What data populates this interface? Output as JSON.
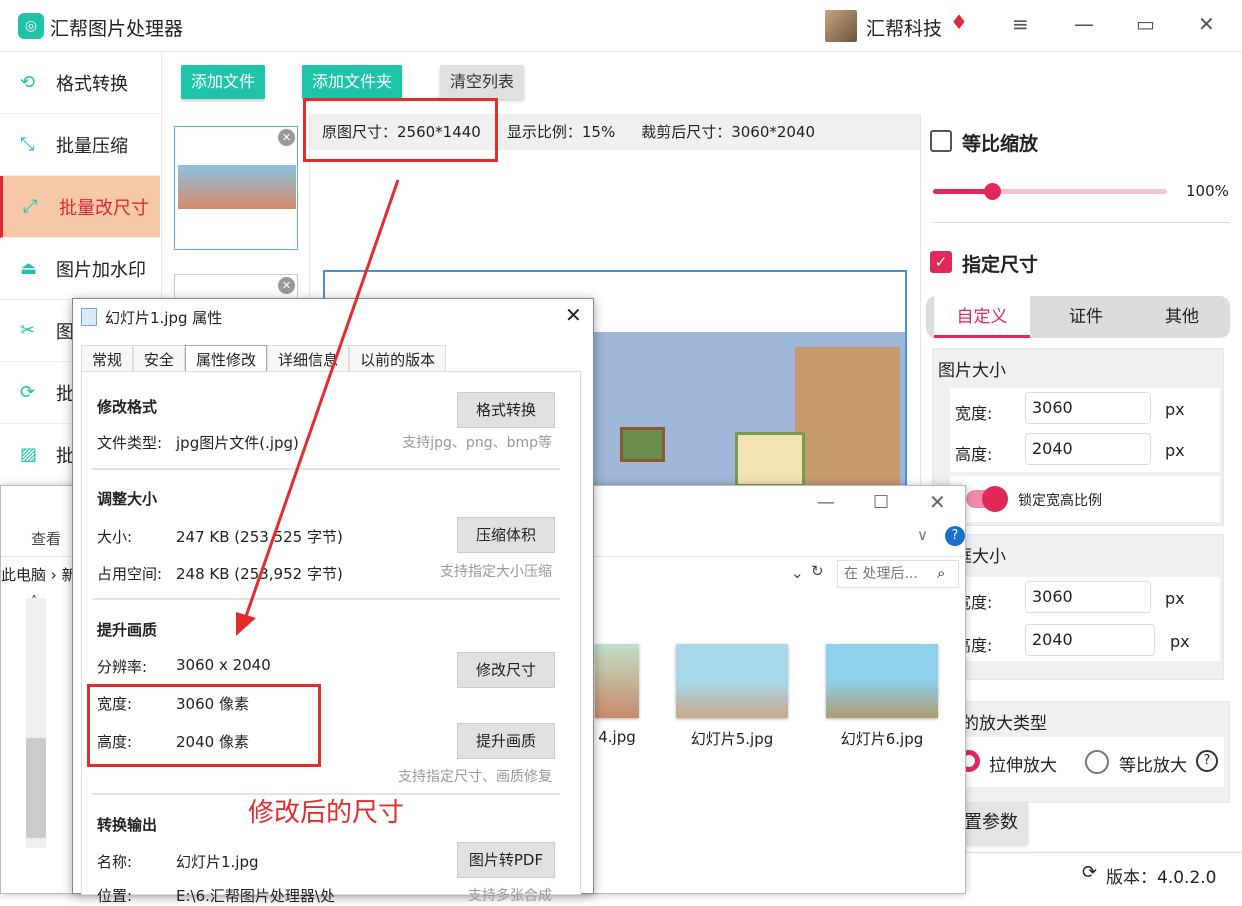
{
  "app": {
    "title": "汇帮图片处理器",
    "user": "汇帮科技",
    "version_label": "版本：4.0.2.0"
  },
  "sidebar": {
    "items": [
      {
        "label": "格式转换",
        "icon": "format-icon"
      },
      {
        "label": "批量压缩",
        "icon": "compress-icon"
      },
      {
        "label": "批量改尺寸",
        "icon": "resize-icon"
      },
      {
        "label": "图片加水印",
        "icon": "watermark-icon"
      },
      {
        "label": "图",
        "icon": "pdf-icon"
      },
      {
        "label": "批",
        "icon": "rotate-icon"
      },
      {
        "label": "批",
        "icon": "image-icon"
      }
    ]
  },
  "toolbar": {
    "add_file": "添加文件",
    "add_folder": "添加文件夹",
    "clear": "清空列表"
  },
  "infobar": {
    "original": "原图尺寸：2560*1440",
    "ratio": "显示比例：15%",
    "cropped": "裁剪后尺寸：3060*2040"
  },
  "right": {
    "proportional": "等比缩放",
    "zoom_value": "100%",
    "zoom_fraction": 0.25,
    "specify": "指定尺寸",
    "tabs": [
      "自定义",
      "证件",
      "其他"
    ],
    "image_size": {
      "title": "图片大小",
      "width_label": "宽度:",
      "width": "3060",
      "height_label": "高度:",
      "height": "2040",
      "unit": "px",
      "lock": "锁定宽高比例"
    },
    "crop_size": {
      "title": "切框大小",
      "width_label": "宽度:",
      "width": "3060",
      "height_label": "高度:",
      "height": "2040",
      "unit": "px"
    },
    "enlarge": {
      "title": "的放大类型",
      "opt1": "拉伸放大",
      "opt2": "等比放大",
      "help": "?"
    },
    "reset": "置参数"
  },
  "explorer": {
    "view": "查看",
    "crumb1": "此电脑",
    "crumb2": "新",
    "search_placeholder": "在 处理后...",
    "files": [
      "4.jpg",
      "幻灯片5.jpg",
      "幻灯片6.jpg"
    ]
  },
  "dialog": {
    "title": "幻灯片1.jpg 属性",
    "tabs": [
      "常规",
      "安全",
      "属性修改",
      "详细信息",
      "以前的版本"
    ],
    "s1": {
      "title": "修改格式",
      "type_label": "文件类型:",
      "type": "jpg图片文件(.jpg)",
      "btn": "格式转换",
      "hint": "支持jpg、png、bmp等"
    },
    "s2": {
      "title": "调整大小",
      "size_label": "大小:",
      "size": "247 KB (253,525 字节)",
      "disk_label": "占用空间:",
      "disk": "248 KB (253,952 字节)",
      "btn": "压缩体积",
      "hint": "支持指定大小压缩"
    },
    "s3": {
      "title": "提升画质",
      "res_label": "分辨率:",
      "res": "3060 x 2040",
      "btn1": "修改尺寸",
      "w_label": "宽度:",
      "w": "3060 像素",
      "h_label": "高度:",
      "h": "2040 像素",
      "btn2": "提升画质",
      "hint": "支持指定尺寸、画质修复"
    },
    "s4": {
      "title": "转换输出",
      "name_label": "名称:",
      "name": "幻灯片1.jpg",
      "loc_label": "位置:",
      "loc": "E:\\6.汇帮图片处理器\\处",
      "btn": "图片转PDF",
      "hint": "支持多张合成"
    }
  },
  "annotation": "修改后的尺寸"
}
